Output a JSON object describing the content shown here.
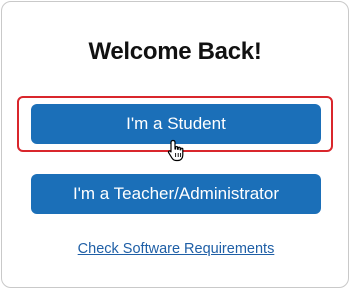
{
  "welcome": {
    "title": "Welcome Back!"
  },
  "buttons": {
    "student_label": "I'm a Student",
    "teacher_label": "I'm a Teacher/Administrator"
  },
  "links": {
    "software_requirements": "Check Software Requirements"
  },
  "colors": {
    "button_blue": "#1b6fb8",
    "highlight_red": "#d9262c",
    "link_blue": "#1f5fa6"
  },
  "icons": {
    "cursor": "hand-pointer-icon"
  }
}
